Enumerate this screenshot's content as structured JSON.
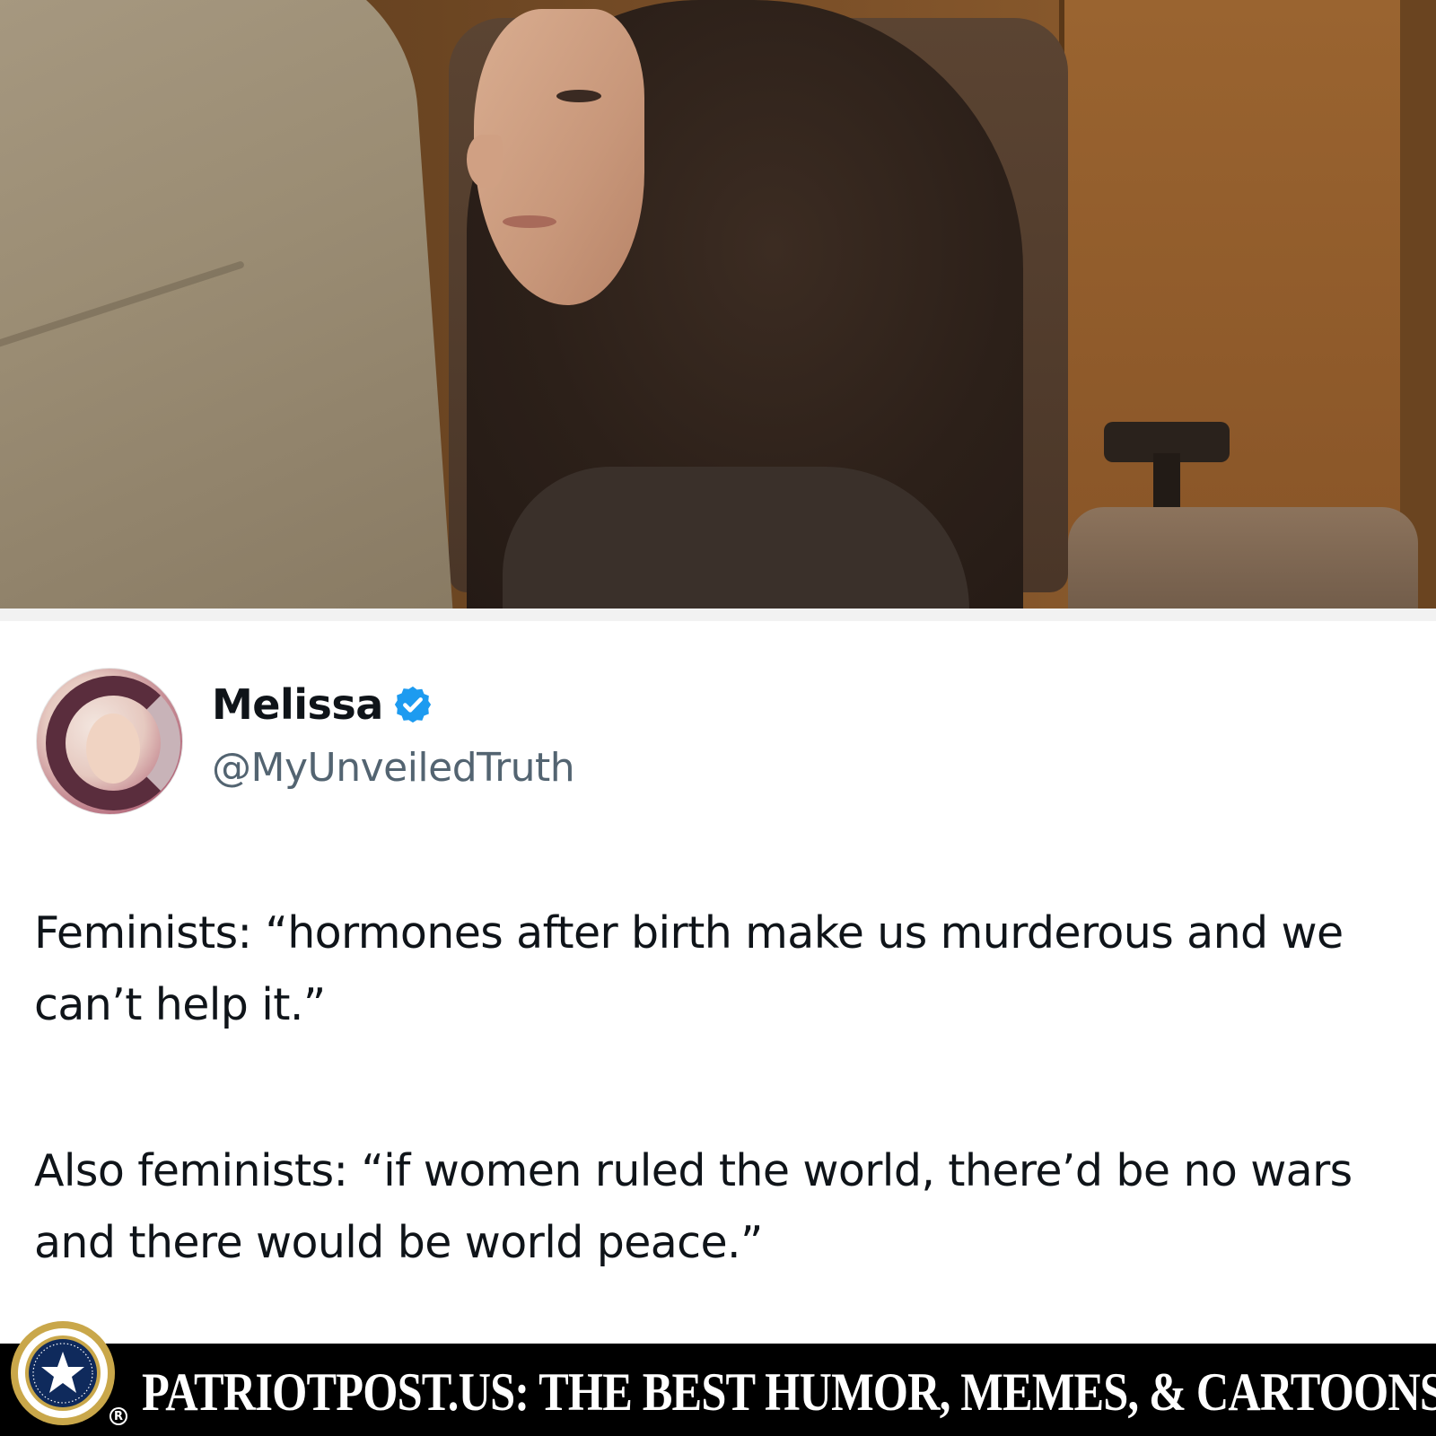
{
  "photo": {
    "description_hidden": ""
  },
  "tweet": {
    "display_name": "Melissa",
    "verified": true,
    "handle": "@MyUnveiledTruth",
    "paragraph_1": "Feminists: “hormones after birth make us murderous and we can’t help it.”",
    "paragraph_2": "Also feminists: “if women ruled the world, there’d be no wars and there would be world peace.”"
  },
  "footer": {
    "banner_text": "PATRIOTPOST.US: THE BEST HUMOR, MEMES, & CARTOONS",
    "registered_mark": "R",
    "seal_text": "VERITAS VOS LIBERABIT · SEMPER VIGILANS FORTIS PARATUS ET FIDELIS"
  },
  "colors": {
    "verified_badge": "#1d9bf0",
    "handle": "#536471",
    "text": "#0f1419",
    "banner_bg": "#000000",
    "seal_gold": "#c9a74a",
    "seal_navy": "#0f2a5c"
  }
}
